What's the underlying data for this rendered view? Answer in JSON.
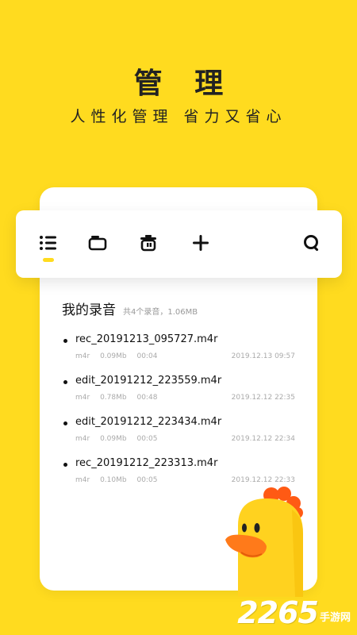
{
  "hero": {
    "title": "管 理",
    "subtitle": "人性化管理 省力又省心"
  },
  "toolbar": {
    "icons": [
      "list-icon",
      "folder-icon",
      "trash-icon",
      "plus-icon",
      "search-icon"
    ],
    "active_index": 0
  },
  "list": {
    "title": "我的录音",
    "summary": "共4个录音，1.06MB",
    "items": [
      {
        "name": "rec_20191213_095727.m4r",
        "format": "m4r",
        "size": "0.09Mb",
        "duration": "00:04",
        "date": "2019.12.13 09:57"
      },
      {
        "name": "edit_20191212_223559.m4r",
        "format": "m4r",
        "size": "0.78Mb",
        "duration": "00:48",
        "date": "2019.12.12 22:35"
      },
      {
        "name": "edit_20191212_223434.m4r",
        "format": "m4r",
        "size": "0.09Mb",
        "duration": "00:05",
        "date": "2019.12.12 22:34"
      },
      {
        "name": "rec_20191212_223313.m4r",
        "format": "m4r",
        "size": "0.10Mb",
        "duration": "00:05",
        "date": "2019.12.12 22:33"
      }
    ]
  },
  "watermark": {
    "number": "2265",
    "text": "手游网"
  },
  "colors": {
    "background": "#FFDB1F",
    "accent": "#FFDB1F",
    "mascot_beak": "#FF7A1A",
    "mascot_comb": "#FF5A14"
  }
}
